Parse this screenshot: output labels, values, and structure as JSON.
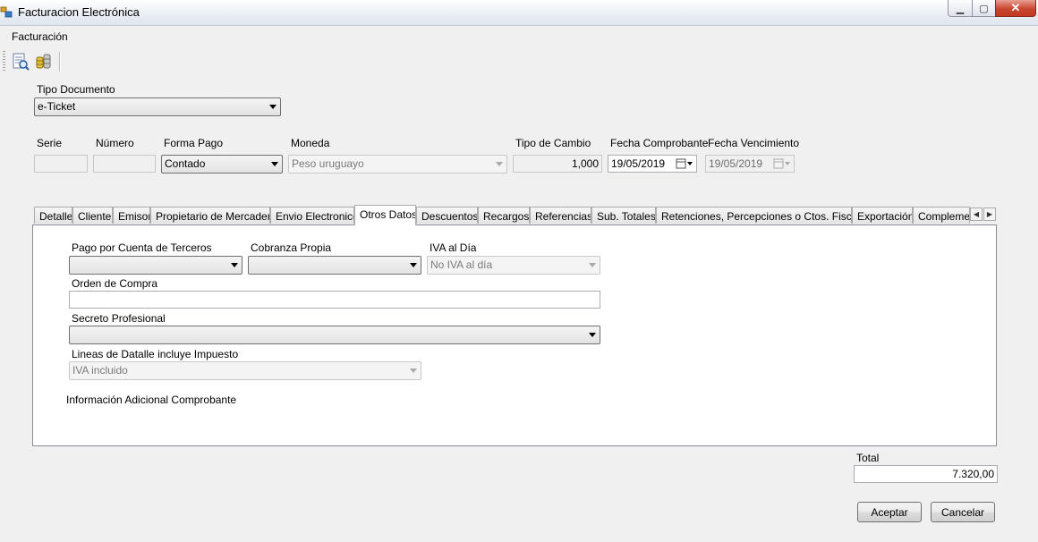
{
  "window": {
    "title": "Facturacion Electrónica"
  },
  "menu": {
    "items": [
      "Facturación"
    ]
  },
  "toolbar": {
    "icons": [
      "document-preview-icon",
      "coins-icon"
    ]
  },
  "header": {
    "tipo_documento": {
      "label": "Tipo Documento",
      "value": "e-Ticket"
    },
    "serie": {
      "label": "Serie",
      "value": ""
    },
    "numero": {
      "label": "Número",
      "value": ""
    },
    "forma_pago": {
      "label": "Forma Pago",
      "value": "Contado"
    },
    "moneda": {
      "label": "Moneda",
      "value": "Peso uruguayo"
    },
    "tipo_cambio": {
      "label": "Tipo de Cambio",
      "value": "1,000"
    },
    "fecha_comprobante": {
      "label": "Fecha Comprobante",
      "value": "19/05/2019"
    },
    "fecha_vencimiento": {
      "label": "Fecha Vencimiento",
      "value": "19/05/2019"
    }
  },
  "tabs": [
    "Detalle",
    "Cliente",
    "Emisor",
    "Propietario de Mercadería",
    "Envio Electronico",
    "Otros Datos",
    "Descuentos",
    "Recargos",
    "Referencias",
    "Sub. Totales",
    "Retenciones, Percepciones o Ctos. Fiscales",
    "Exportación",
    "Complementos"
  ],
  "active_tab": "Otros Datos",
  "otros_datos": {
    "pago_cuenta_terceros": {
      "label": "Pago por Cuenta de Terceros",
      "value": ""
    },
    "cobranza_propia": {
      "label": "Cobranza Propia",
      "value": ""
    },
    "iva_al_dia": {
      "label": "IVA al Día",
      "value": "No IVA al día"
    },
    "orden_compra": {
      "label": "Orden de Compra",
      "value": ""
    },
    "secreto_profesional": {
      "label": "Secreto Profesional",
      "value": ""
    },
    "lineas_detalle": {
      "label": "Lineas de Datalle incluye Impuesto",
      "value": "IVA incluido"
    },
    "info_adicional": {
      "label": "Información Adicional Comprobante"
    }
  },
  "footer": {
    "total": {
      "label": "Total",
      "value": "7.320,00"
    },
    "accept_label": "Aceptar",
    "cancel_label": "Cancelar"
  },
  "colors": {
    "panel_bg": "#f0f0f0",
    "close_button": "#c9452d",
    "input_border": "#abadb3"
  }
}
